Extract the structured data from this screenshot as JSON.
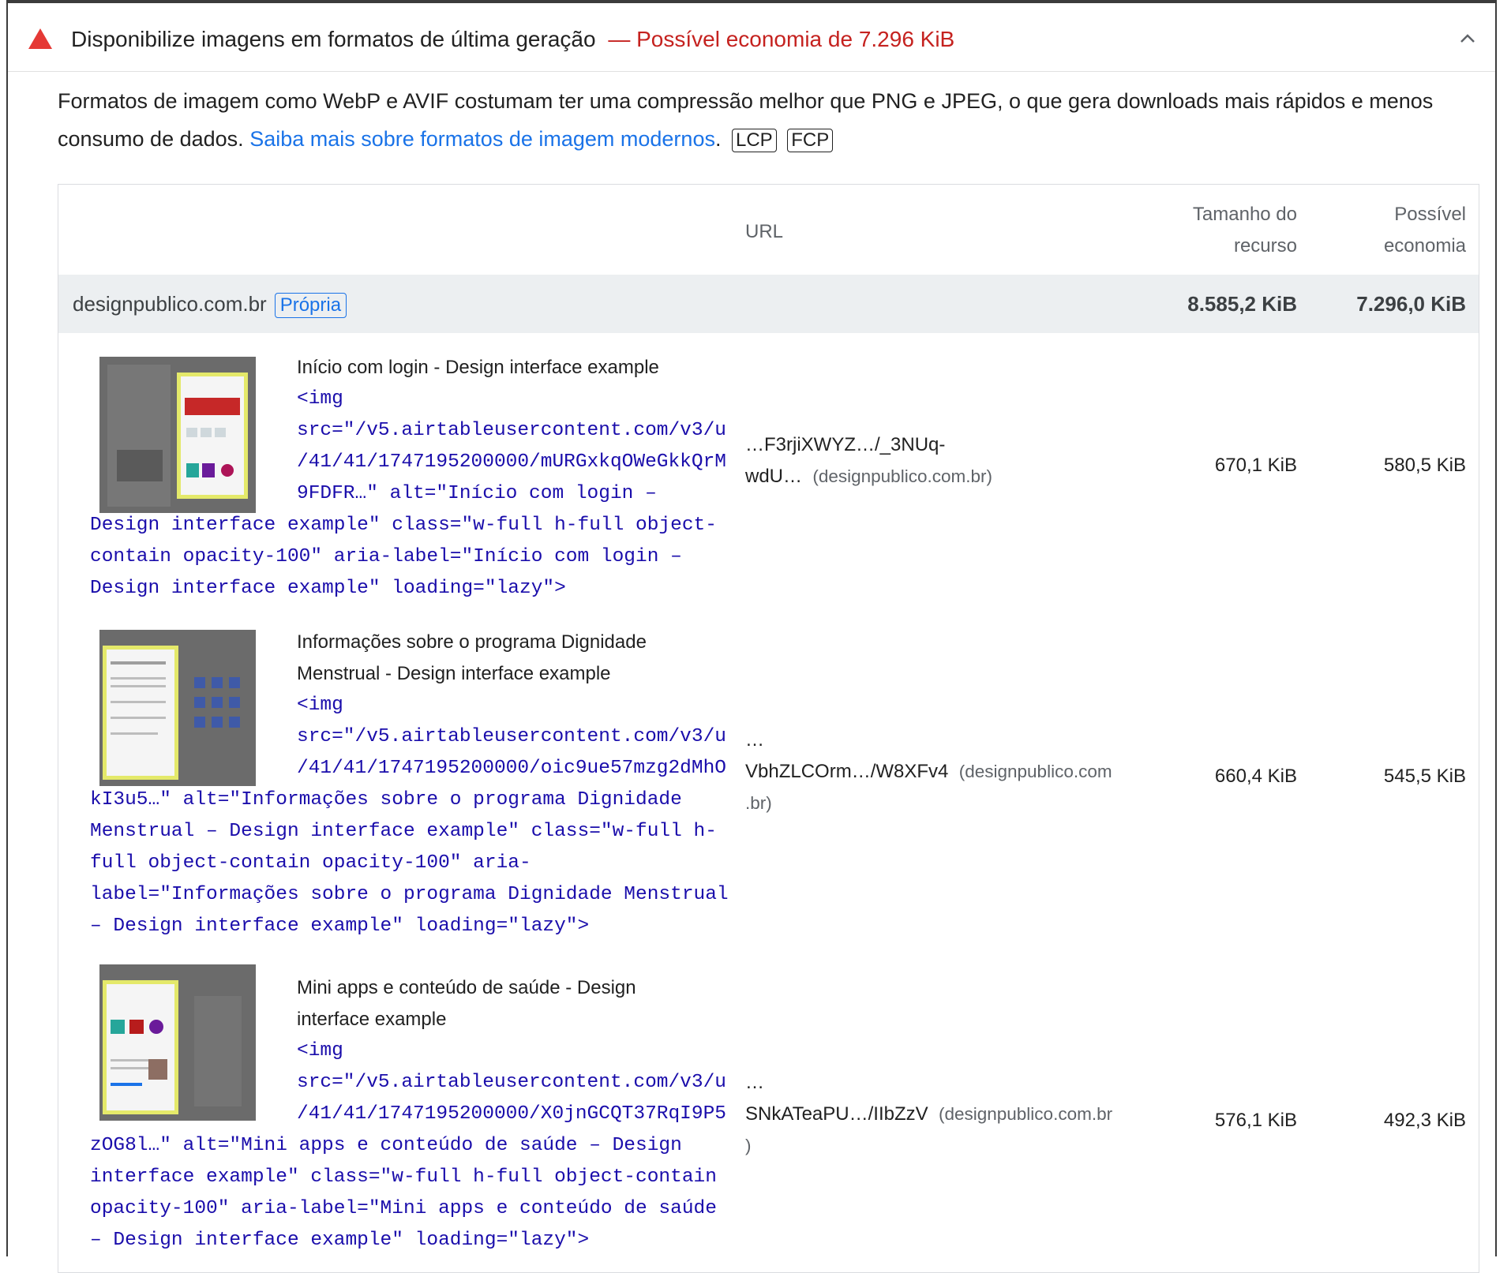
{
  "audit": {
    "title": "Disponibilize imagens em formatos de última geração",
    "savings": "— Possível economia de 7.296 KiB",
    "description": "Formatos de imagem como WebP e AVIF costumam ter uma compressão melhor que PNG e JPEG, o que gera downloads mais rápidos e menos consumo de dados.",
    "link": "Saiba mais sobre formatos de imagem modernos",
    "after_link": ".",
    "tags": [
      "LCP",
      "FCP"
    ],
    "icons": {
      "status": "warning-triangle-icon",
      "toggle": "chevron-up-icon"
    },
    "colors": {
      "warning": "#e53935",
      "savings": "#c5221f",
      "link": "#1a73e8",
      "code": "#1a0dab"
    }
  },
  "table": {
    "headers": {
      "url": "URL",
      "size_1": "Tamanho do",
      "size_2": "recurso",
      "save_1": "Possível",
      "save_2": "economia"
    },
    "group": {
      "name": "designpublico.com.br",
      "badge": "Própria",
      "size": "8.585,2 KiB",
      "savings": "7.296,0 KiB"
    },
    "rows": [
      {
        "label_1": "Início com login - Design interface example",
        "label_2": "",
        "snippet_indent": [
          "<img",
          "src=\"/v5.airtableusercontent.com/v3/u",
          "/41/41/1747195200000/mURGxkqOWeGkkQrM",
          "9FDFR…\" alt=\"Início com login –"
        ],
        "snippet_full": [
          "Design interface example\" class=\"w-full h-full object-",
          "contain opacity-100\" aria-label=\"Início com login –",
          "Design interface example\" loading=\"lazy\">"
        ],
        "url_1": "…F3rjiXWYZ…/_3NUq-",
        "url_2": "wdU…",
        "host": "(designpublico.com.br)",
        "size": "670,1 KiB",
        "savings": "580,5 KiB"
      },
      {
        "label_1": "Informações sobre o programa Dignidade",
        "label_2": "Menstrual - Design interface example",
        "snippet_indent": [
          "<img",
          "src=\"/v5.airtableusercontent.com/v3/u",
          "/41/41/1747195200000/oic9ue57mzg2dMhO"
        ],
        "snippet_full": [
          "kI3u5…\" alt=\"Informações sobre o programa Dignidade",
          "Menstrual – Design interface example\" class=\"w-full h-",
          "full object-contain opacity-100\" aria-",
          "label=\"Informações sobre o programa Dignidade Menstrual",
          "– Design interface example\" loading=\"lazy\">"
        ],
        "url_1": "…",
        "url_2": "VbhZLCOrm…/W8XFv4",
        "host_1": "(designpublico.com",
        "host_2": ".br)",
        "size": "660,4 KiB",
        "savings": "545,5 KiB"
      },
      {
        "label_1": "Mini apps e conteúdo de saúde - Design",
        "label_2": "interface example",
        "snippet_indent": [
          "<img",
          "src=\"/v5.airtableusercontent.com/v3/u",
          "/41/41/1747195200000/X0jnGCQT37RqI9P5"
        ],
        "snippet_full": [
          "zOG8l…\" alt=\"Mini apps e conteúdo de saúde – Design",
          "interface example\" class=\"w-full h-full object-contain",
          "opacity-100\" aria-label=\"Mini apps e conteúdo de saúde",
          "– Design interface example\" loading=\"lazy\">"
        ],
        "url_1": "…",
        "url_2": "SNkATeaPU…/IIbZzV",
        "host_1": "(designpublico.com.br",
        "host_2": ")",
        "size": "576,1 KiB",
        "savings": "492,3 KiB"
      }
    ]
  }
}
